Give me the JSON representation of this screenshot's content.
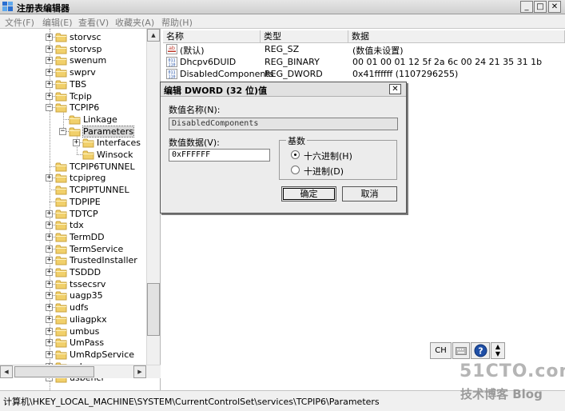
{
  "window": {
    "title": "注册表编辑器",
    "minimize_glyph": "_",
    "maximize_glyph": "□",
    "close_glyph": "✕"
  },
  "menu": [
    "文件(F)",
    "编辑(E)",
    "查看(V)",
    "收藏夹(A)",
    "帮助(H)"
  ],
  "tree": [
    {
      "label": "storvsc",
      "expander": "+"
    },
    {
      "label": "storvsp",
      "expander": "+"
    },
    {
      "label": "swenum",
      "expander": "+"
    },
    {
      "label": "swprv",
      "expander": "+"
    },
    {
      "label": "TBS",
      "expander": "+"
    },
    {
      "label": "Tcpip",
      "expander": "+"
    },
    {
      "label": "TCPIP6",
      "expander": "−"
    },
    {
      "label": "Linkage",
      "expander": ""
    },
    {
      "label": "Parameters",
      "expander": "−",
      "selected": true
    },
    {
      "label": "Interfaces",
      "expander": "+"
    },
    {
      "label": "Winsock",
      "expander": ""
    },
    {
      "label": "TCPIP6TUNNEL",
      "expander": ""
    },
    {
      "label": "tcpipreg",
      "expander": "+"
    },
    {
      "label": "TCPIPTUNNEL",
      "expander": ""
    },
    {
      "label": "TDPIPE",
      "expander": ""
    },
    {
      "label": "TDTCP",
      "expander": "+"
    },
    {
      "label": "tdx",
      "expander": "+"
    },
    {
      "label": "TermDD",
      "expander": "+"
    },
    {
      "label": "TermService",
      "expander": "+"
    },
    {
      "label": "TrustedInstaller",
      "expander": "+"
    },
    {
      "label": "TSDDD",
      "expander": "+"
    },
    {
      "label": "tssecsrv",
      "expander": "+"
    },
    {
      "label": "uagp35",
      "expander": "+"
    },
    {
      "label": "udfs",
      "expander": "+"
    },
    {
      "label": "uliagpkx",
      "expander": "+"
    },
    {
      "label": "umbus",
      "expander": "+"
    },
    {
      "label": "UmPass",
      "expander": "+"
    },
    {
      "label": "UmRdpService",
      "expander": "+"
    },
    {
      "label": "usbccgp",
      "expander": "+"
    },
    {
      "label": "usbehci",
      "expander": "+"
    }
  ],
  "list": {
    "headers": {
      "name": "名称",
      "type": "类型",
      "data": "数据"
    },
    "rows": [
      {
        "icon": "string-value-icon",
        "name": "(默认)",
        "type": "REG_SZ",
        "data": "(数值未设置)"
      },
      {
        "icon": "binary-value-icon",
        "name": "Dhcpv6DUID",
        "type": "REG_BINARY",
        "data": "00 01 00 01 12 5f 2a 6c 00 24 21 35 31 1b"
      },
      {
        "icon": "binary-value-icon",
        "name": "DisabledComponents",
        "type": "REG_DWORD",
        "data": "0x41ffffff (1107296255)"
      }
    ]
  },
  "dialog": {
    "title": "编辑 DWORD (32 位)值",
    "close_glyph": "✕",
    "value_name_label": "数值名称(N):",
    "value_name": "DisabledComponents",
    "value_data_label": "数值数据(V):",
    "value_data": "0xFFFFFF",
    "base_label": "基数",
    "hex_label": "十六进制(H)",
    "dec_label": "十进制(D)",
    "base_selected": "hex",
    "ok_label": "确定",
    "cancel_label": "取消"
  },
  "status": {
    "path": "计算机\\HKEY_LOCAL_MACHINE\\SYSTEM\\CurrentControlSet\\services\\TCPIP6\\Parameters"
  },
  "ime": {
    "lang": "CH",
    "help_glyph": "?"
  },
  "watermark": {
    "site": "51CTO.com",
    "tagline": "技术博客 Blog"
  },
  "colors": {
    "folder": "#f1d06b",
    "folder_dark": "#c9a23d",
    "help_blue": "#1f4fa6",
    "selection": "#d9d9d9"
  }
}
